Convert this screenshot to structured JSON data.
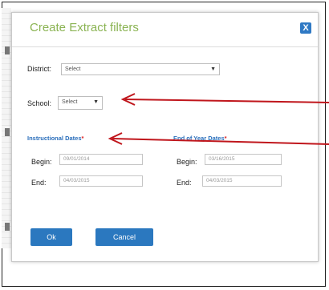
{
  "dialog": {
    "title": "Create Extract filters",
    "close_label": "X"
  },
  "district": {
    "label": "District:",
    "value": "Select"
  },
  "school": {
    "label": "School:",
    "value": "Select"
  },
  "instructional_dates": {
    "label": "Instructional Dates",
    "required_mark": "*",
    "begin_label": "Begin:",
    "begin_value": "09/01/2014",
    "end_label": "End:",
    "end_value": "04/03/2015"
  },
  "end_of_year_dates": {
    "label": "End of Year Dates",
    "required_mark": "*",
    "begin_label": "Begin:",
    "begin_value": "03/16/2015",
    "end_label": "End:",
    "end_value": "04/03/2015"
  },
  "buttons": {
    "ok": "Ok",
    "cancel": "Cancel"
  },
  "colors": {
    "title": "#8ab352",
    "section_label": "#2a6ebb",
    "button": "#2b78bf",
    "annotation_arrow": "#c0161c"
  }
}
